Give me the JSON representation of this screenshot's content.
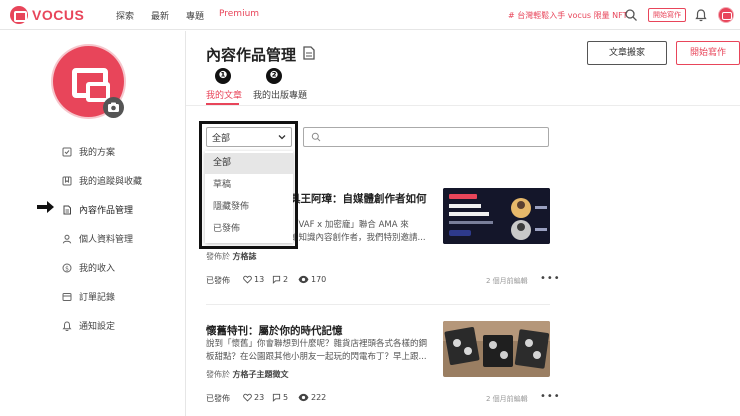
{
  "topbar": {
    "logo": "VOCUS",
    "nav": [
      "探索",
      "最新",
      "專題",
      "Premium"
    ],
    "promo": "# 台灣輕鬆入手 vocus 限量 NFT",
    "start_writing": "開始寫作",
    "icons": [
      "search-icon",
      "bell-icon",
      "avatar"
    ]
  },
  "sidebar": {
    "items": [
      {
        "label": "我的方案",
        "icon": "plan-icon"
      },
      {
        "label": "我的追蹤與收藏",
        "icon": "bookmark-icon"
      },
      {
        "label": "內容作品管理",
        "icon": "document-icon",
        "active": true
      },
      {
        "label": "個人資料管理",
        "icon": "person-icon"
      },
      {
        "label": "我的收入",
        "icon": "dollar-icon"
      },
      {
        "label": "訂單記錄",
        "icon": "receipt-icon"
      },
      {
        "label": "通知設定",
        "icon": "bell-icon"
      }
    ]
  },
  "main": {
    "title": "內容作品管理",
    "btn_move": "文章搬家",
    "btn_write": "開始寫作",
    "annotations": [
      "❶",
      "❷"
    ],
    "tabs": [
      {
        "label": "我的文章",
        "active": true
      },
      {
        "label": "我的出版專題",
        "active": false
      }
    ],
    "filter": {
      "selected": "全部",
      "options": [
        "全部",
        "草稿",
        "隱藏發佈",
        "已發佈"
      ]
    },
    "articles": [
      {
        "title": "具王阿璋：自媒體創作者如何",
        "desc1": "「VAF x 加密龐」聯合 AMA 來",
        "desc2": "如知識內容創作者，我們特別邀請...",
        "publish_prefix": "發佈於",
        "publisher": "方格誌",
        "status": "已發佈",
        "likes": "13",
        "comments": "2",
        "views": "170",
        "ago": "2 個月前編輯"
      },
      {
        "title": "懷舊特刊：屬於你的時代記憶",
        "desc1": "說到「懷舊」你會聯想到什麼呢？雜貨店裡頭各式各樣的鋼",
        "desc2": "板甜點？在公園跟其他小朋友一起玩的閃電布丁？早上跟...",
        "publish_prefix": "發佈於",
        "publisher": "方格子主題徵文",
        "status": "已發佈",
        "likes": "23",
        "comments": "5",
        "views": "222",
        "ago": "2 個月前編輯"
      }
    ]
  },
  "colors": {
    "accent": "#e8455a",
    "text": "#333333"
  }
}
